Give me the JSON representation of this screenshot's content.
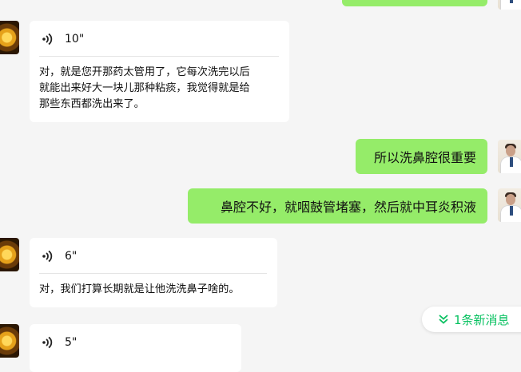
{
  "messages": [
    {
      "side": "left",
      "type": "voice",
      "duration": "10\"",
      "transcript": "对，就是您开那药太管用了，它每次洗完以后\n就能出来好大一块儿那种粘痰，我觉得就是给\n那些东西都洗出来了。"
    },
    {
      "side": "right",
      "type": "text",
      "text": "所以洗鼻腔很重要"
    },
    {
      "side": "right",
      "type": "text",
      "text": "鼻腔不好，就咽鼓管堵塞，然后就中耳炎积液"
    },
    {
      "side": "left",
      "type": "voice",
      "duration": "6\"",
      "transcript": "对，我们打算长期就是让他洗洗鼻子啥的。"
    },
    {
      "side": "left",
      "type": "voice",
      "duration": "5\""
    }
  ],
  "new_message_pill": {
    "label": "1条新消息",
    "icon": "double-chevron-down-icon"
  },
  "colors": {
    "background": "#f5f5f5",
    "green_bubble": "#95ec69",
    "accent": "#07c160"
  }
}
